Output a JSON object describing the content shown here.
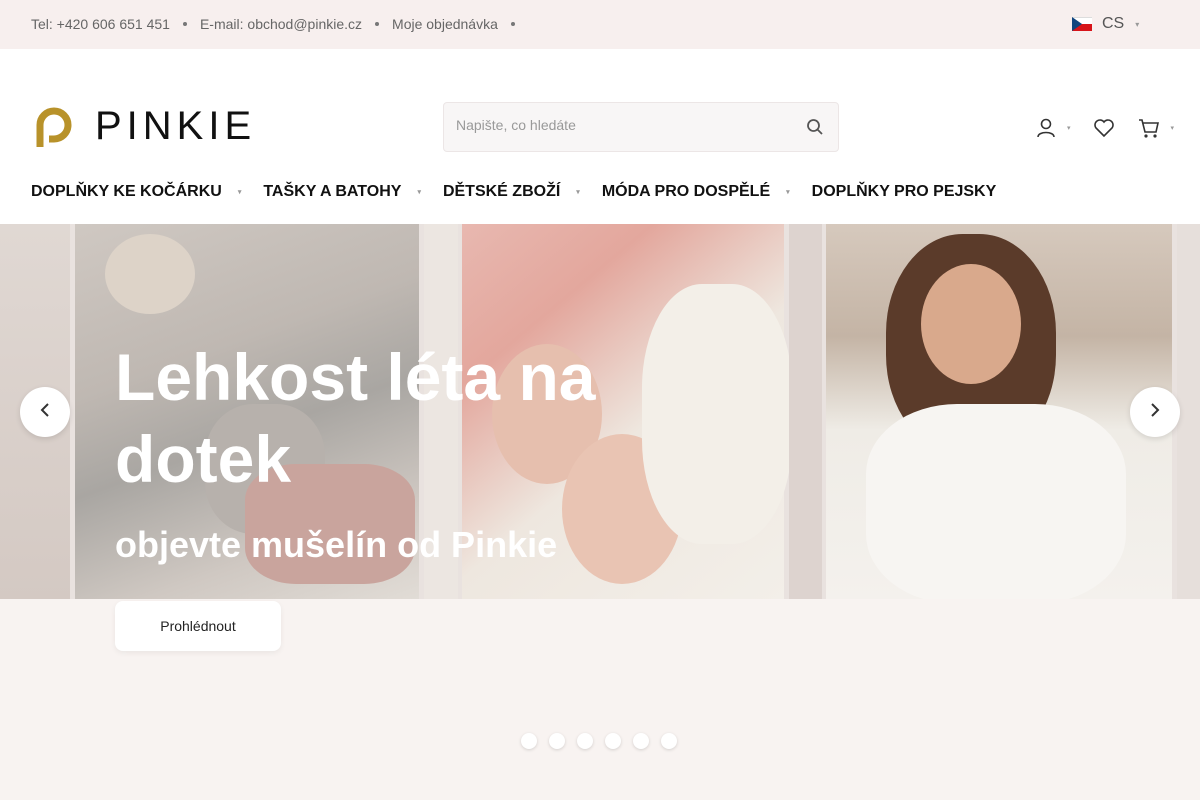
{
  "topbar": {
    "phone": "Tel: +420 606 651 451",
    "email": "E-mail: obchod@pinkie.cz",
    "order": "Moje objednávka",
    "language": "CS"
  },
  "header": {
    "logo_text": "PINKIE",
    "search_placeholder": "Napište, co hledáte"
  },
  "nav": {
    "items": [
      {
        "label": "DOPLŇKY KE KOČÁRKU"
      },
      {
        "label": "TAŠKY A BATOHY"
      },
      {
        "label": "DĚTSKÉ ZBOŽÍ"
      },
      {
        "label": "MÓDA PRO DOSPĚLÉ"
      },
      {
        "label": "DOPLŇKY PRO PEJSKY"
      }
    ]
  },
  "hero": {
    "title": "Lehkost léta na dotek",
    "subtitle": "objevte mušelín od Pinkie",
    "cta_label": "Prohlédnout",
    "slide_count": 6
  },
  "colors": {
    "brand_gold": "#b8922a",
    "topbar_bg": "#f7efee",
    "page_bg": "#f8f3f1"
  },
  "icons": [
    "flag-cz-icon",
    "search-icon",
    "user-icon",
    "heart-icon",
    "cart-icon",
    "arrow-left-icon",
    "arrow-right-icon"
  ]
}
